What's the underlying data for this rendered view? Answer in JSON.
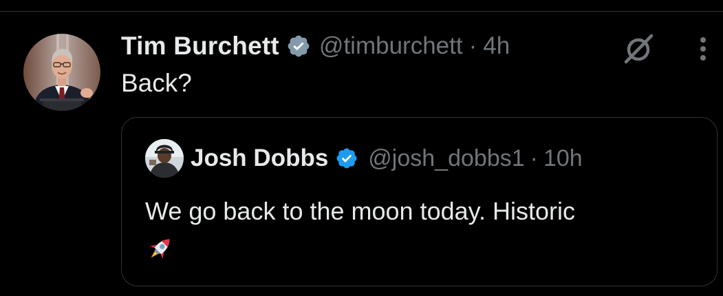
{
  "post": {
    "author_name": "Tim Burchett",
    "handle": "@timburchett",
    "separator": "·",
    "time": "4h",
    "text": "Back?",
    "verified_icon": "verified-badge-gray-icon",
    "avatar": "avatar-man-in-suit"
  },
  "actions": {
    "grok_icon": "grok-icon",
    "more_icon": "more-vertical-icon"
  },
  "quote": {
    "author_name": "Josh Dobbs",
    "handle": "@josh_dobbs1",
    "separator": "·",
    "time": "10h",
    "text": "We go back to the moon today. Historic",
    "emoji": "rocket-emoji",
    "verified_icon": "verified-badge-blue-icon"
  },
  "colors": {
    "background": "#000000",
    "primary_text": "#e7e9ea",
    "secondary_text": "#71767b",
    "border": "#2f3336",
    "verified_blue": "#1d9bf0",
    "verified_gray": "#829aab"
  }
}
